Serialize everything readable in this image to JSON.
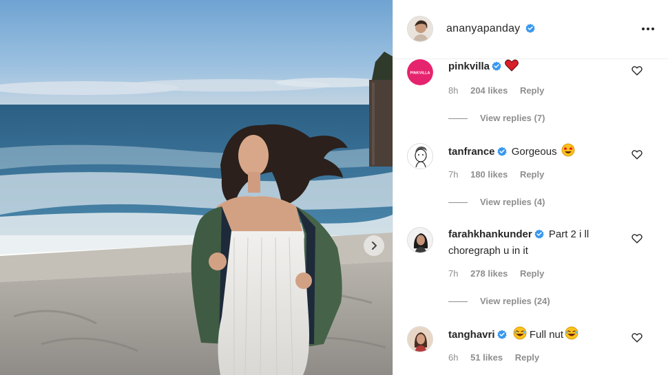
{
  "post": {
    "author": "ananyapanday",
    "author_verified": true,
    "more_icon": "more-horizontal-icon",
    "next_icon": "chevron-right-icon"
  },
  "comments": [
    {
      "username": "pinkvilla",
      "verified": true,
      "avatar_text": "PINKVILLA",
      "avatar_color": "#e6236e",
      "text": "",
      "emoji": "heart",
      "time": "8h",
      "likes": "204 likes",
      "reply": "Reply",
      "view_replies": "View replies (7)"
    },
    {
      "username": "tanfrance",
      "verified": true,
      "text": "Gorgeous",
      "emoji": "heart-eyes",
      "time": "7h",
      "likes": "180 likes",
      "reply": "Reply",
      "view_replies": "View replies (4)"
    },
    {
      "username": "farahkhankunder",
      "verified": true,
      "text": "Part 2 i ll choregraph u in it",
      "time": "7h",
      "likes": "278 likes",
      "reply": "Reply",
      "view_replies": "View replies (24)"
    },
    {
      "username": "tanghavri",
      "verified": true,
      "text": "Full nut",
      "emoji": "laughing",
      "time": "6h",
      "likes": "51 likes",
      "reply": "Reply"
    }
  ],
  "colors": {
    "verified_blue": "#3897f0",
    "text_primary": "#262626",
    "text_secondary": "#8e8e8e"
  }
}
